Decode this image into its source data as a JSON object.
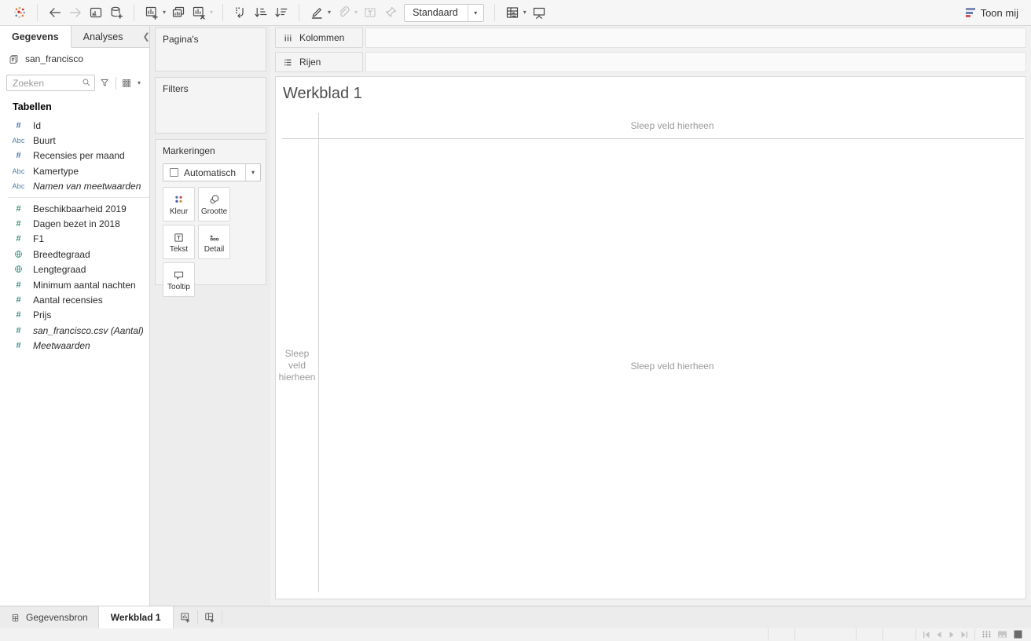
{
  "toolbar": {
    "fit_value": "Standaard",
    "show_me_label": "Toon mij",
    "groups": [
      {
        "items": [
          {
            "name": "tableau-logo",
            "icon": "tableau-logo",
            "enabled": true
          }
        ]
      },
      {
        "items": [
          {
            "name": "undo",
            "icon": "arrow-left",
            "enabled": true
          },
          {
            "name": "redo",
            "icon": "arrow-right",
            "enabled": false
          },
          {
            "name": "save",
            "icon": "save",
            "enabled": true
          },
          {
            "name": "add-data",
            "icon": "database-plus",
            "enabled": true
          }
        ]
      },
      {
        "items": [
          {
            "name": "new-worksheet",
            "icon": "new-worksheet",
            "enabled": true,
            "caret": true,
            "caret_enabled": true
          },
          {
            "name": "duplicate-sheet",
            "icon": "duplicate",
            "enabled": true
          },
          {
            "name": "clear-sheet",
            "icon": "clear-sheet",
            "enabled": true,
            "caret": true,
            "caret_enabled": false
          }
        ]
      },
      {
        "items": [
          {
            "name": "swap-rows-columns",
            "icon": "swap",
            "enabled": true
          },
          {
            "name": "sort-ascending",
            "icon": "sort-asc",
            "enabled": true
          },
          {
            "name": "sort-descending",
            "icon": "sort-desc",
            "enabled": true
          }
        ]
      },
      {
        "items": [
          {
            "name": "highlight",
            "icon": "highlight-pen",
            "enabled": true,
            "caret": true,
            "caret_enabled": true
          },
          {
            "name": "group-members",
            "icon": "paperclip",
            "enabled": false,
            "caret": true,
            "caret_enabled": false
          },
          {
            "name": "show-mark-labels",
            "icon": "label-box",
            "enabled": false
          },
          {
            "name": "fix-axes",
            "icon": "pin",
            "enabled": false
          },
          {
            "type": "dropdown",
            "name": "fit-dropdown"
          }
        ]
      },
      {
        "items": [
          {
            "name": "show-me-panel",
            "icon": "show-me-grid",
            "enabled": true,
            "caret": true,
            "caret_enabled": true
          },
          {
            "name": "presentation-mode",
            "icon": "presentation",
            "enabled": true
          }
        ]
      }
    ]
  },
  "sidebar": {
    "tabs": [
      {
        "label": "Gegevens"
      },
      {
        "label": "Analyses"
      }
    ],
    "datasource": "san_francisco",
    "search_placeholder": "Zoeken",
    "section_header": "Tabellen",
    "sections": [
      {
        "fields": [
          {
            "label": "Id",
            "icon": "hash",
            "role": "dimension",
            "italic": false
          },
          {
            "label": "Buurt",
            "icon": "abc",
            "role": "dimension",
            "italic": false
          },
          {
            "label": "Recensies per maand",
            "icon": "hash",
            "role": "dimension",
            "italic": false
          },
          {
            "label": "Kamertype",
            "icon": "abc",
            "role": "dimension",
            "italic": false
          },
          {
            "label": "Namen van meetwaarden",
            "icon": "abc",
            "role": "dimension",
            "italic": true
          }
        ]
      },
      {
        "fields": [
          {
            "label": "Beschikbaarheid 2019",
            "icon": "hash",
            "role": "measure",
            "italic": false
          },
          {
            "label": "Dagen bezet in 2018",
            "icon": "hash",
            "role": "measure",
            "italic": false
          },
          {
            "label": "F1",
            "icon": "hash",
            "role": "measure",
            "italic": false
          },
          {
            "label": "Breedtegraad",
            "icon": "globe",
            "role": "measure",
            "italic": false
          },
          {
            "label": "Lengtegraad",
            "icon": "globe",
            "role": "measure",
            "italic": false
          },
          {
            "label": "Minimum aantal nachten",
            "icon": "hash",
            "role": "measure",
            "italic": false
          },
          {
            "label": "Aantal recensies",
            "icon": "hash",
            "role": "measure",
            "italic": false
          },
          {
            "label": "Prijs",
            "icon": "hash",
            "role": "measure",
            "italic": false
          },
          {
            "label": "san_francisco.csv (Aantal)",
            "icon": "hash",
            "role": "measure",
            "italic": true
          },
          {
            "label": "Meetwaarden",
            "icon": "hash",
            "role": "measure",
            "italic": true
          }
        ]
      }
    ]
  },
  "cards": {
    "pages_label": "Pagina's",
    "filters_label": "Filters",
    "marks": {
      "title": "Markeringen",
      "dropdown_value": "Automatisch",
      "buttons": [
        {
          "label": "Kleur",
          "icon": "kleur"
        },
        {
          "label": "Grootte",
          "icon": "grootte"
        },
        {
          "label": "Tekst",
          "icon": "tekst"
        },
        {
          "label": "Detail",
          "icon": "detail"
        },
        {
          "label": "Tooltip",
          "icon": "tooltip"
        }
      ]
    }
  },
  "shelves": {
    "columns_label": "Kolommen",
    "rows_label": "Rijen"
  },
  "canvas": {
    "title": "Werkblad 1",
    "drop_top": "Sleep veld hierheen",
    "drop_center": "Sleep veld hierheen",
    "drop_left_lines": [
      "Sleep",
      "veld",
      "hierheen"
    ]
  },
  "bottom": {
    "datasource_tab": "Gegevensbron",
    "sheet_tab": "Werkblad 1"
  },
  "colors": {
    "dimension_icon": "#4c7ba7",
    "measure_icon": "#3a9183",
    "drop_hint": "#9b9b9b",
    "mark_dot_blue": "#4f6da8",
    "mark_dot_dark_blue": "#3f5d99",
    "mark_dot_red": "#c9504b",
    "mark_dot_orange": "#d98a3d",
    "showme_bar_purple": "#7d88b3",
    "showme_bar_blue": "#6b7fae",
    "showme_bar_red": "#cf5459"
  }
}
